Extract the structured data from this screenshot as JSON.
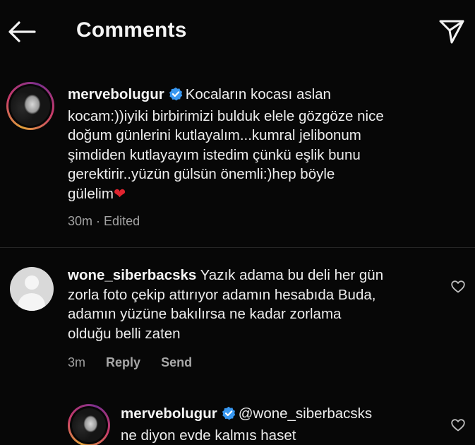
{
  "header": {
    "title": "Comments",
    "back_icon": "arrow-left-icon",
    "share_icon": "paper-plane-icon"
  },
  "caption": {
    "username": "mervebolugur",
    "verified": true,
    "lines": [
      "Kocaların kocası aslan",
      "kocam:))iyiki birbirimizi bulduk elele gözgöze nice",
      "doğum günlerini kutlayalım...kumral jelibonum",
      "şimdiden kutlayayım istedim çünkü eşlik bunu",
      "gerektirir..yüzün gülsün önemli:)hep böyle",
      "gülelim"
    ],
    "trailing_emoji": "❤",
    "time": "30m",
    "separator": "·",
    "edited_label": "Edited"
  },
  "comments": [
    {
      "username": "wone_siberbacsks",
      "lines": [
        "Yazık adama bu deli her gün",
        "zorla foto çekip attırıyor adamın hesabıda Buda,",
        "adamın yüzüne bakılırsa ne kadar zorlama",
        "olduğu belli zaten"
      ],
      "time": "3m",
      "reply_label": "Reply",
      "send_label": "Send"
    }
  ],
  "replies": [
    {
      "username": "mervebolugur",
      "verified": true,
      "lines": [
        "@wone_siberbacsks",
        "ne diyon evde kalmıs haset"
      ]
    }
  ],
  "colors": {
    "background": "#070707",
    "text": "#ededed",
    "meta_text": "#a3a3a3",
    "verified_badge": "#3897f0",
    "heart": "#e0242f"
  }
}
